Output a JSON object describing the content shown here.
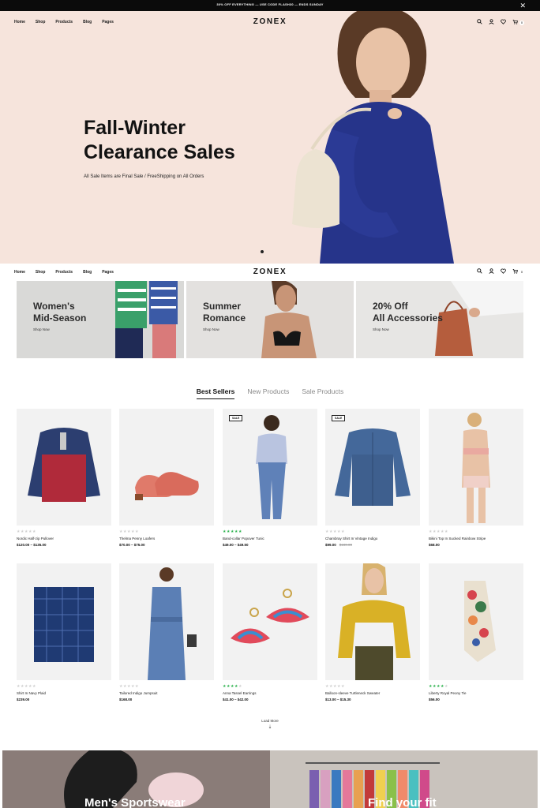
{
  "announcement": {
    "text": "30% OFF EVERYTHING — USE CODE FLASH30 — ENDS SUNDAY",
    "close_icon": "close-icon"
  },
  "nav": {
    "links": [
      "Home",
      "Shop",
      "Products",
      "Blog",
      "Pages"
    ],
    "logo": "ZONEX",
    "icons": [
      "search-icon",
      "user-icon",
      "heart-icon",
      "cart-icon"
    ],
    "cart_count": "0"
  },
  "hero": {
    "title_line1": "Fall-Winter",
    "title_line2": "Clearance Sales",
    "subtitle": "All Sale Items are Final Sale / FreeShipping on All Orders",
    "background": "#f6e4dc"
  },
  "banners": [
    {
      "line1": "Women's",
      "line2": "Mid-Season",
      "cta": "Shop Now"
    },
    {
      "line1": "Summer",
      "line2": "Romance",
      "cta": "Shop Now"
    },
    {
      "line1": "20% Off",
      "line2": "All Accessories",
      "cta": "Shop Now"
    }
  ],
  "tabs": [
    {
      "label": "Best Sellers",
      "active": true
    },
    {
      "label": "New Products",
      "active": false
    },
    {
      "label": "Sale Products",
      "active": false
    }
  ],
  "products": [
    {
      "name": "Nordic Half-zip Pullover",
      "price": "$120.00 – $135.00",
      "rating": 0,
      "sale": false
    },
    {
      "name": "Thelma Penny Loafers",
      "price": "$70.00 – $75.00",
      "rating": 0,
      "sale": false
    },
    {
      "name": "Band-collar Popover Tunic",
      "price": "$49.00 – $49.50",
      "rating": 5,
      "sale": true,
      "sale_label": "SALE"
    },
    {
      "name": "Chambray Shirt In Vintage Indigo",
      "price": "$99.00",
      "old_price": "$180.00",
      "rating": 0,
      "sale": true,
      "sale_label": "SALE"
    },
    {
      "name": "Bikini Top In Sucked Rainbow Stripe",
      "price": "$68.00",
      "rating": 0,
      "sale": false
    },
    {
      "name": "Shirt In Navy Plaid",
      "price": "$239.00",
      "rating": 0,
      "sale": false
    },
    {
      "name": "Tailored Indigo Jumpsuit",
      "price": "$168.00",
      "rating": 0,
      "sale": false
    },
    {
      "name": "Anna Tassel Earrings",
      "price": "$41.00 – $42.00",
      "rating": 4,
      "sale": false
    },
    {
      "name": "Balloon-sleeve Turtleneck Sweater",
      "price": "$13.00 – $15.30",
      "rating": 0,
      "sale": false
    },
    {
      "name": "Liberty Royal Peony Tie",
      "price": "$56.00",
      "rating": 4,
      "sale": false
    }
  ],
  "load_more": "Load More",
  "bottom_banners": [
    {
      "title": "Men's Sportswear"
    },
    {
      "title": "Find your fit"
    }
  ],
  "colors": {
    "star": "#2bb24c",
    "star_empty": "#d0d0d0",
    "accent": "#111111"
  }
}
